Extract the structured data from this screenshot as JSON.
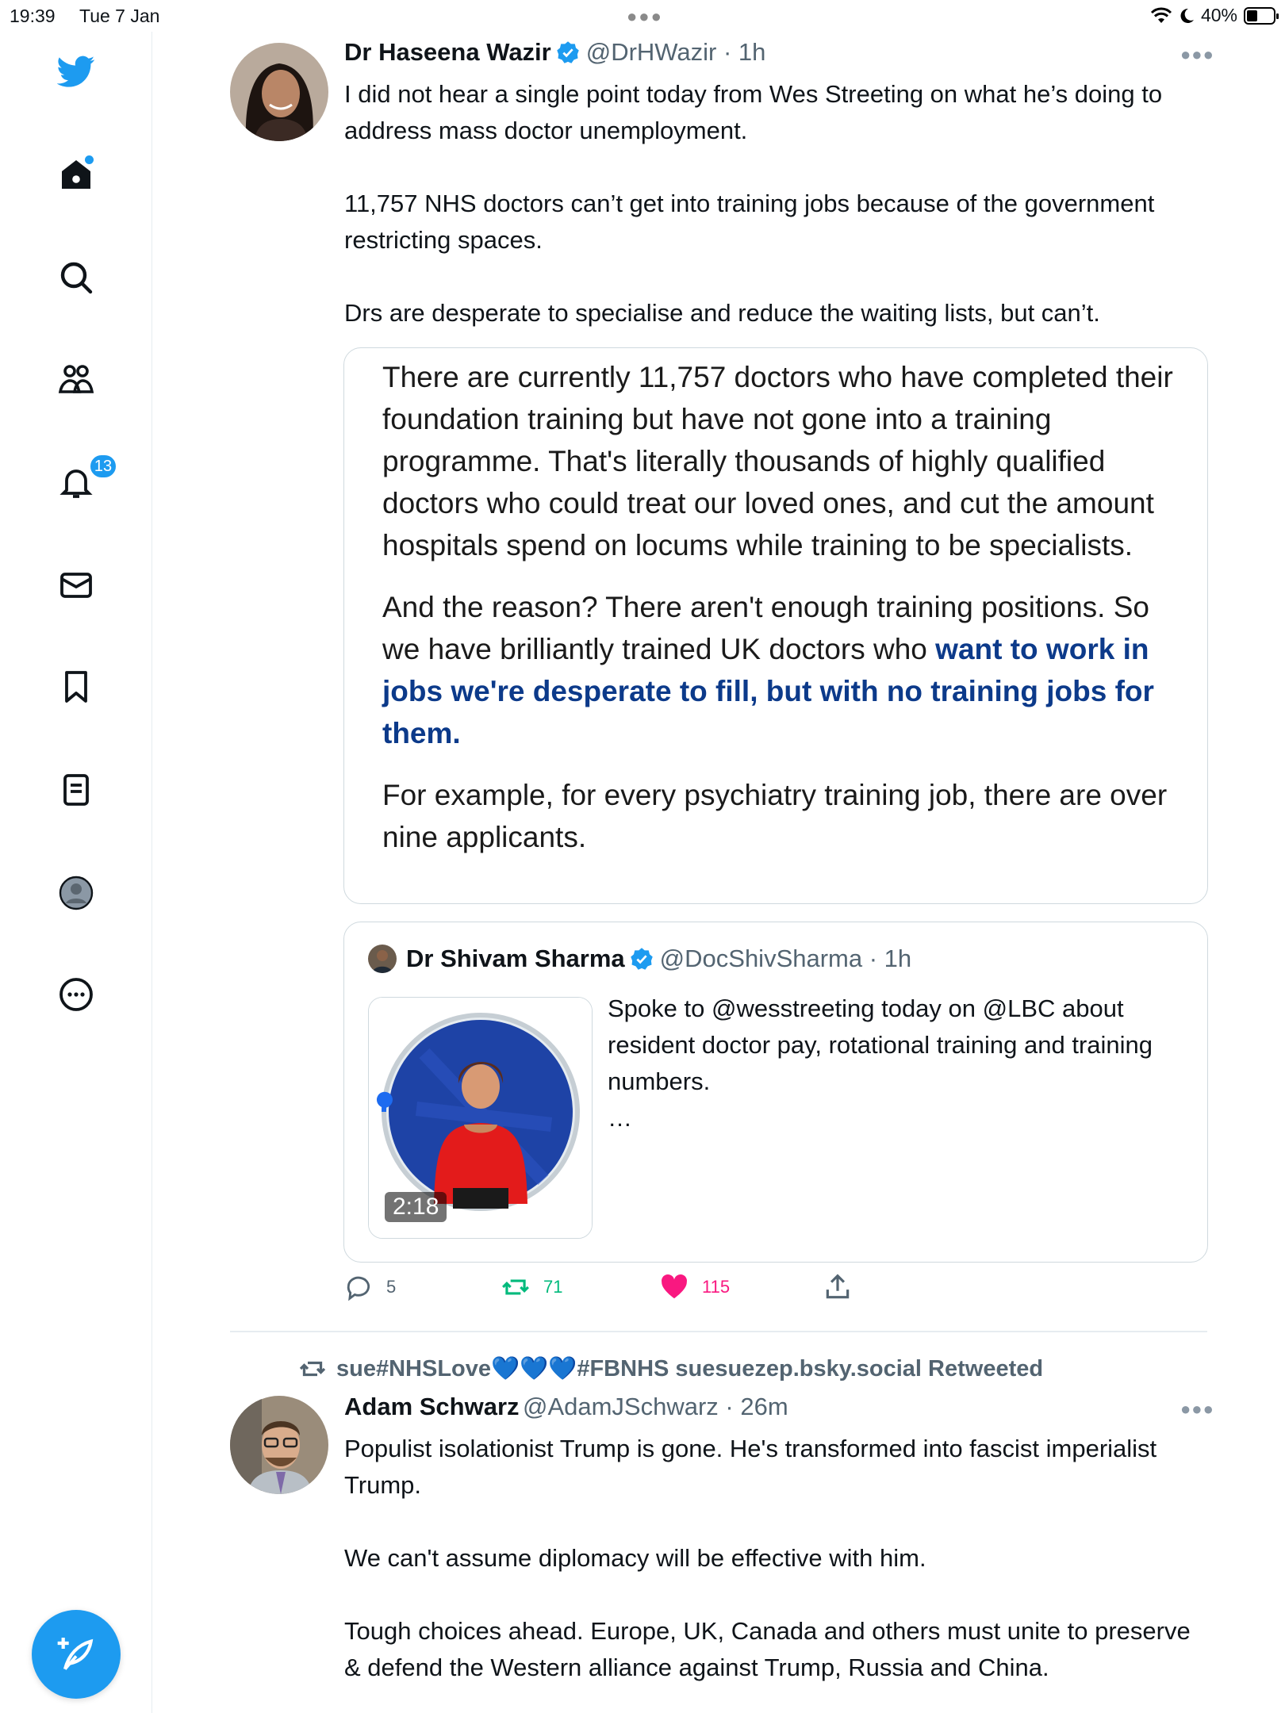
{
  "status_bar": {
    "time": "19:39",
    "date": "Tue 7 Jan",
    "battery": "40%",
    "battery_level": 0.4
  },
  "sidebar": {
    "notifications_badge": "13",
    "items": [
      "twitter-logo",
      "home-icon",
      "search-icon",
      "communities-icon",
      "notifications-icon",
      "messages-icon",
      "bookmarks-icon",
      "lists-icon",
      "profile-icon",
      "more-icon"
    ]
  },
  "colors": {
    "accent": "#1d9bf0",
    "retweet": "#00ba7c",
    "like": "#f91880",
    "highlight": "#0c3a8a"
  },
  "tweet1": {
    "name": "Dr Haseena Wazir",
    "handle": "@DrHWazir · 1h",
    "text_p1": "I did not hear a single point today from Wes Streeting on what he’s doing to address mass doctor unemployment.",
    "text_p2": "11,757 NHS doctors can’t get into training jobs because of the government restricting spaces.",
    "text_p3": "Drs are desperate to specialise and reduce the waiting lists, but can’t.",
    "image_text": {
      "p1": "There are currently 11,757 doctors who have completed their foundation training but have not gone into a training programme. That's literally thousands of highly qualified doctors who could treat our loved ones, and cut the amount hospitals spend on locums while training to be specialists.",
      "p2_plain": "And the reason? There aren't enough training positions. So we have brilliantly trained UK doctors who ",
      "p2_highlight": "want to work in jobs we're desperate to fill, but with no training jobs for them",
      "p2_end": ".",
      "p3": "For example, for every psychiatry training job, there are over nine applicants."
    },
    "quoted": {
      "name": "Dr Shivam Sharma",
      "handle": "@DocShivSharma · 1h",
      "text": "Spoke to @wesstreeting today on @LBC about resident doctor pay, rotational training and training numbers.",
      "ellipsis": "…",
      "video_duration": "2:18",
      "video_progress": 0.02
    },
    "replies": "5",
    "retweets": "71",
    "likes": "115"
  },
  "tweet2": {
    "retweeted_by": "sue#NHSLove💙💙💙#FBNHS suesuezep.bsky.social Retweeted",
    "name": "Adam Schwarz",
    "handle": "@AdamJSchwarz · 26m",
    "text_p1": "Populist isolationist Trump is gone. He's transformed into fascist imperialist Trump.",
    "text_p2": "We can't assume diplomacy will be effective with him.",
    "text_p3": "Tough choices ahead. Europe, UK, Canada and others must unite to preserve & defend the Western alliance against Trump, Russia and China."
  }
}
